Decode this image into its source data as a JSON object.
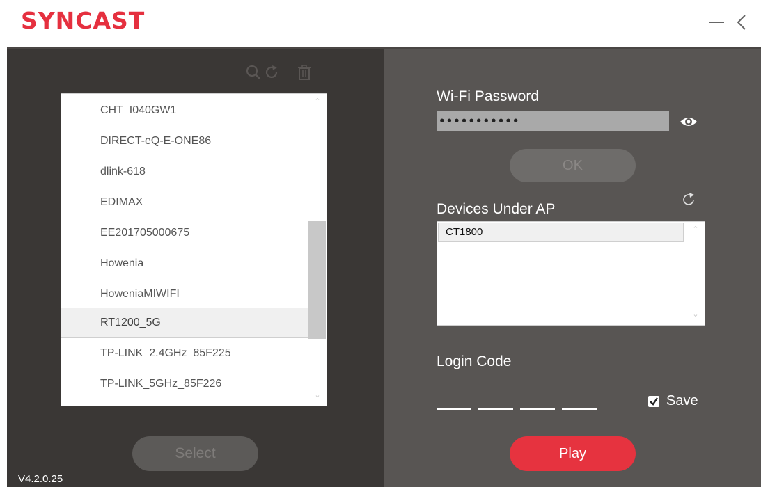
{
  "app": {
    "logo": "SYNCAST",
    "version": "V4.2.0.25"
  },
  "window": {
    "minimize_icon": "minimize-icon",
    "back_icon": "chevron-left-icon"
  },
  "toolbar": {
    "icons": [
      "search-icon",
      "refresh-icon",
      "trash-icon"
    ]
  },
  "ssid_list": {
    "items": [
      "CHT_I040GW1",
      "DIRECT-eQ-E-ONE86",
      "dlink-618",
      "EDIMAX",
      "EE201705000675",
      "Howenia",
      "HoweniaMIWIFI",
      "RT1200_5G",
      "TP-LINK_2.4GHz_85F225",
      "TP-LINK_5GHz_85F226"
    ],
    "selected": "RT1200_5G",
    "scroll_position_fraction": 0.55
  },
  "select_button": {
    "label": "Select"
  },
  "wifi": {
    "label": "Wi-Fi Password",
    "password_masked": "•••••••••••"
  },
  "ok_button": {
    "label": "OK"
  },
  "devices": {
    "label": "Devices Under AP",
    "items": [
      "CT1800"
    ]
  },
  "login": {
    "label": "Login Code",
    "save_label": "Save",
    "save_checked": true
  },
  "play_button": {
    "label": "Play"
  },
  "colors": {
    "accent": "#e6333f",
    "left_panel": "#3a3735",
    "right_panel": "#585553",
    "disabled_button": "#5c5a58"
  }
}
